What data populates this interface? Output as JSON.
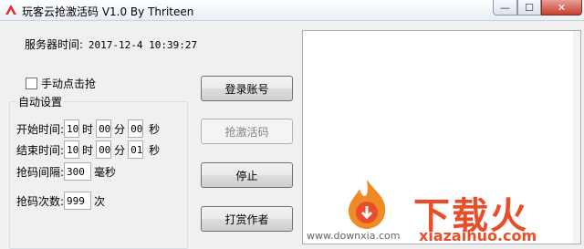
{
  "window": {
    "title": "玩客云抢激活码 V1.0   By Thriteen",
    "min_glyph": "—",
    "max_glyph": "☐",
    "close_glyph": "✕"
  },
  "server": {
    "label": "服务器时间:",
    "value": "2017-12-4 10:39:27"
  },
  "manual": {
    "label": "手动点击抢",
    "checked": false
  },
  "auto": {
    "title": "自动设置",
    "start": {
      "label": "开始时间:",
      "hour": "10",
      "hour_unit": "时",
      "minute": "00",
      "minute_unit": "分",
      "second": "00",
      "second_unit": "秒"
    },
    "end": {
      "label": "结束时间:",
      "hour": "10",
      "hour_unit": "时",
      "minute": "00",
      "minute_unit": "分",
      "second": "01",
      "second_unit": "秒"
    },
    "interval": {
      "label": "抢码间隔:",
      "value": "300",
      "unit": "毫秒"
    },
    "count": {
      "label": "抢码次数:",
      "value": "999",
      "unit": "次"
    }
  },
  "buttons": {
    "login": "登录账号",
    "grab": "抢激活码",
    "stop": "停止",
    "donate": "打赏作者"
  },
  "watermark": {
    "url": "www.downxia.com",
    "brand": "下载火",
    "site": "xiazaihuo.com"
  },
  "colors": {
    "brand": "#e94e2a"
  }
}
